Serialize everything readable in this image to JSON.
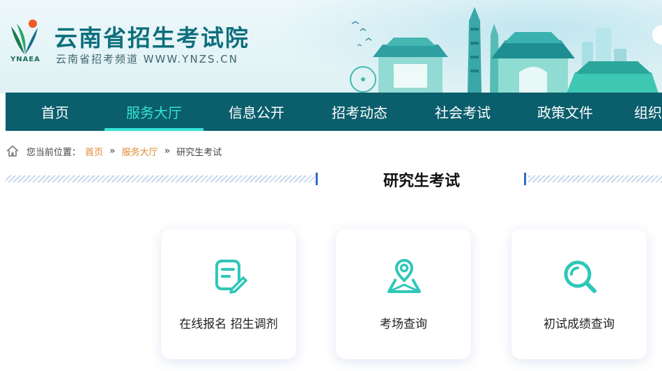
{
  "header": {
    "logo_text": "YNAEA",
    "title": "云南省招生考试院",
    "subtitle": "云南省招考频道 WWW.YNZS.CN"
  },
  "nav": {
    "items": [
      {
        "label": "首页"
      },
      {
        "label": "服务大厅",
        "active": true
      },
      {
        "label": "信息公开"
      },
      {
        "label": "招考动态"
      },
      {
        "label": "社会考试"
      },
      {
        "label": "政策文件"
      },
      {
        "label": "组织"
      }
    ]
  },
  "breadcrumb": {
    "prefix": "您当前位置：",
    "items": [
      "首页",
      "服务大厅",
      "研究生考试"
    ],
    "separator": "»"
  },
  "section": {
    "title": "研究生考试"
  },
  "cards": [
    {
      "label": "在线报名 招生调剂",
      "icon": "document-edit-icon"
    },
    {
      "label": "考场查询",
      "icon": "location-map-icon"
    },
    {
      "label": "初试成绩查询",
      "icon": "search-icon"
    }
  ],
  "colors": {
    "nav_bg": "#0b5e6c",
    "nav_active": "#34e3d4",
    "breadcrumb_link": "#e08a2e",
    "icon_teal": "#2fc7b9",
    "title_teal": "#0e6f7c"
  }
}
